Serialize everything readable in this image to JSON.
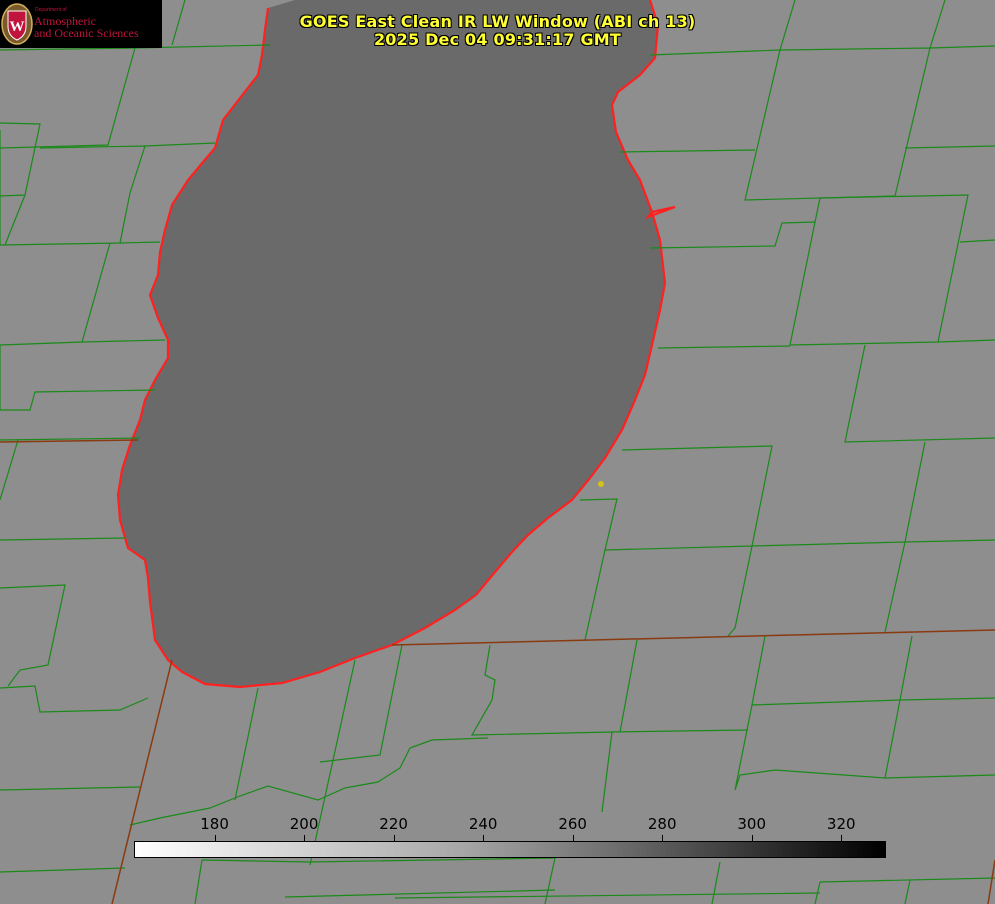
{
  "title": {
    "line1": "GOES East Clean IR LW Window (ABI ch 13)",
    "line2": "2025 Dec 04 09:31:17 GMT"
  },
  "logo": {
    "dept": "Department of",
    "line1": "Atmospheric",
    "line2": "and Oceanic Sciences",
    "shield_letter": "W",
    "color": "#c0143c"
  },
  "colorbar": {
    "ticks": [
      180,
      200,
      220,
      240,
      260,
      280,
      300,
      320
    ],
    "range": [
      162,
      330
    ],
    "colors": {
      "low": "#ffffff",
      "high": "#000000"
    }
  },
  "map_colors": {
    "land": "#8e8e8e",
    "lake": "#6a6a6a",
    "shoreline": "#ff2020",
    "county_lines": "#1a8a1a",
    "state_lines": "#8a3a10",
    "marker": "#d4c21a"
  },
  "marker": {
    "name": "station-dot"
  }
}
